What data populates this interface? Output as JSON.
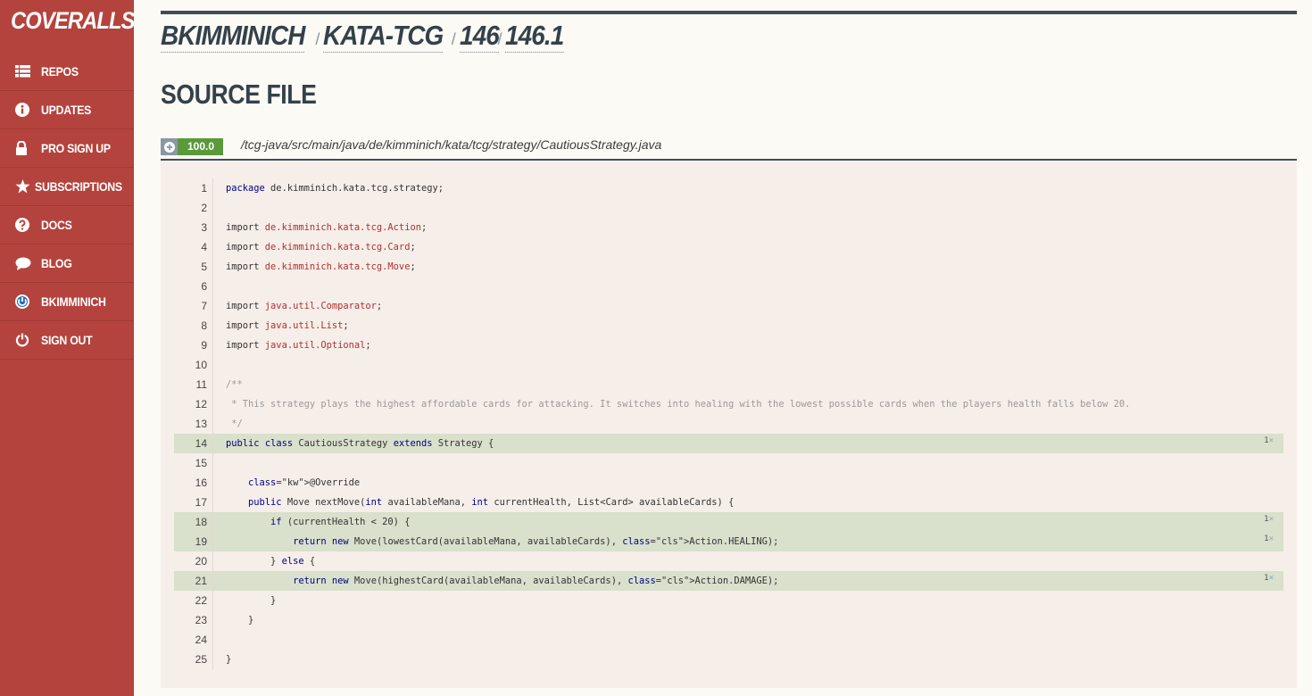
{
  "brand": "COVERALLS",
  "nav": [
    {
      "label": "REPOS",
      "icon": "list-icon"
    },
    {
      "label": "UPDATES",
      "icon": "info-icon"
    },
    {
      "label": "PRO SIGN UP",
      "icon": "lock-icon"
    },
    {
      "label": "SUBSCRIPTIONS",
      "icon": "star-icon"
    },
    {
      "label": "DOCS",
      "icon": "question-icon"
    },
    {
      "label": "BLOG",
      "icon": "comment-icon"
    },
    {
      "label": "BKIMMINICH",
      "icon": "github-icon"
    },
    {
      "label": "SIGN OUT",
      "icon": "power-icon"
    }
  ],
  "breadcrumb": [
    "BKIMMINICH",
    "KATA-TCG",
    "146",
    "146.1"
  ],
  "page_title": "SOURCE FILE",
  "file": {
    "coverage": "100.0",
    "path": "/tcg-java/src/main/java/de/kimminich/kata/tcg/strategy/CautiousStrategy.java"
  },
  "colors": {
    "sidebar": "#b5433d",
    "covered_line": "#d9e0cc",
    "coverage_badge": "#5a9a3a",
    "header_bar": "#3e4d58"
  },
  "source_lines": [
    {
      "n": "1",
      "text": "package de.kimminich.kata.tcg.strategy;",
      "covered": false,
      "hits": ""
    },
    {
      "n": "2",
      "text": "",
      "covered": false,
      "hits": ""
    },
    {
      "n": "3",
      "text": "import de.kimminich.kata.tcg.Action;",
      "covered": false,
      "hits": ""
    },
    {
      "n": "4",
      "text": "import de.kimminich.kata.tcg.Card;",
      "covered": false,
      "hits": ""
    },
    {
      "n": "5",
      "text": "import de.kimminich.kata.tcg.Move;",
      "covered": false,
      "hits": ""
    },
    {
      "n": "6",
      "text": "",
      "covered": false,
      "hits": ""
    },
    {
      "n": "7",
      "text": "import java.util.Comparator;",
      "covered": false,
      "hits": ""
    },
    {
      "n": "8",
      "text": "import java.util.List;",
      "covered": false,
      "hits": ""
    },
    {
      "n": "9",
      "text": "import java.util.Optional;",
      "covered": false,
      "hits": ""
    },
    {
      "n": "10",
      "text": "",
      "covered": false,
      "hits": ""
    },
    {
      "n": "11",
      "text": "/**",
      "covered": false,
      "hits": ""
    },
    {
      "n": "12",
      "text": " * This strategy plays the highest affordable cards for attacking. It switches into healing with the lowest possible cards when the players health falls below 20.",
      "covered": false,
      "hits": ""
    },
    {
      "n": "13",
      "text": " */",
      "covered": false,
      "hits": ""
    },
    {
      "n": "14",
      "text": "public class CautiousStrategy extends Strategy {",
      "covered": true,
      "hits": "1"
    },
    {
      "n": "15",
      "text": "",
      "covered": false,
      "hits": ""
    },
    {
      "n": "16",
      "text": "    @Override",
      "covered": false,
      "hits": ""
    },
    {
      "n": "17",
      "text": "    public Move nextMove(int availableMana, int currentHealth, List<Card> availableCards) {",
      "covered": false,
      "hits": ""
    },
    {
      "n": "18",
      "text": "        if (currentHealth < 20) {",
      "covered": true,
      "hits": "1"
    },
    {
      "n": "19",
      "text": "            return new Move(lowestCard(availableMana, availableCards), Action.HEALING);",
      "covered": true,
      "hits": "1"
    },
    {
      "n": "20",
      "text": "        } else {",
      "covered": false,
      "hits": ""
    },
    {
      "n": "21",
      "text": "            return new Move(highestCard(availableMana, availableCards), Action.DAMAGE);",
      "covered": true,
      "hits": "1"
    },
    {
      "n": "22",
      "text": "        }",
      "covered": false,
      "hits": ""
    },
    {
      "n": "23",
      "text": "    }",
      "covered": false,
      "hits": ""
    },
    {
      "n": "24",
      "text": "",
      "covered": false,
      "hits": ""
    },
    {
      "n": "25",
      "text": "}",
      "covered": false,
      "hits": ""
    }
  ]
}
